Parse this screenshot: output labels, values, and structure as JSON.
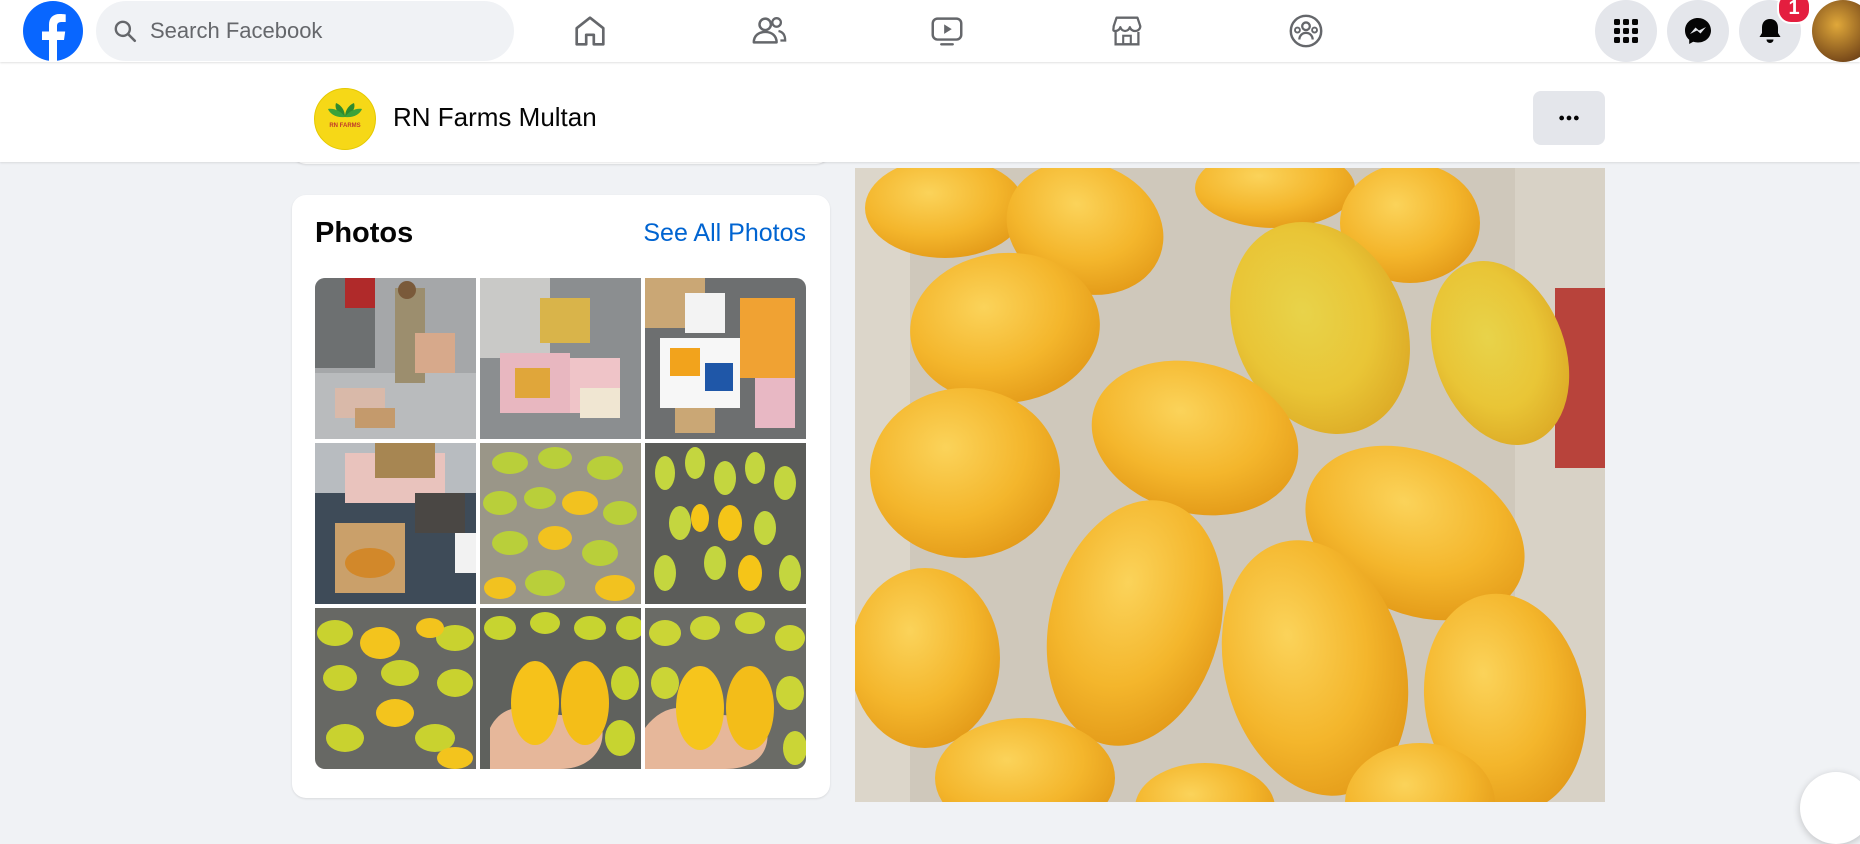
{
  "topbar": {
    "search": {
      "placeholder": "Search Facebook"
    },
    "notifications_count": "1"
  },
  "page_header": {
    "page_name": "RN Farms Multan",
    "logo_text": "RN FARMS"
  },
  "photos": {
    "title": "Photos",
    "see_all_label": "See All Photos"
  },
  "colors": {
    "brand_blue": "#0866ff",
    "link_blue": "#0064d1",
    "badge_red": "#e41e3f",
    "background": "#f0f2f5"
  }
}
